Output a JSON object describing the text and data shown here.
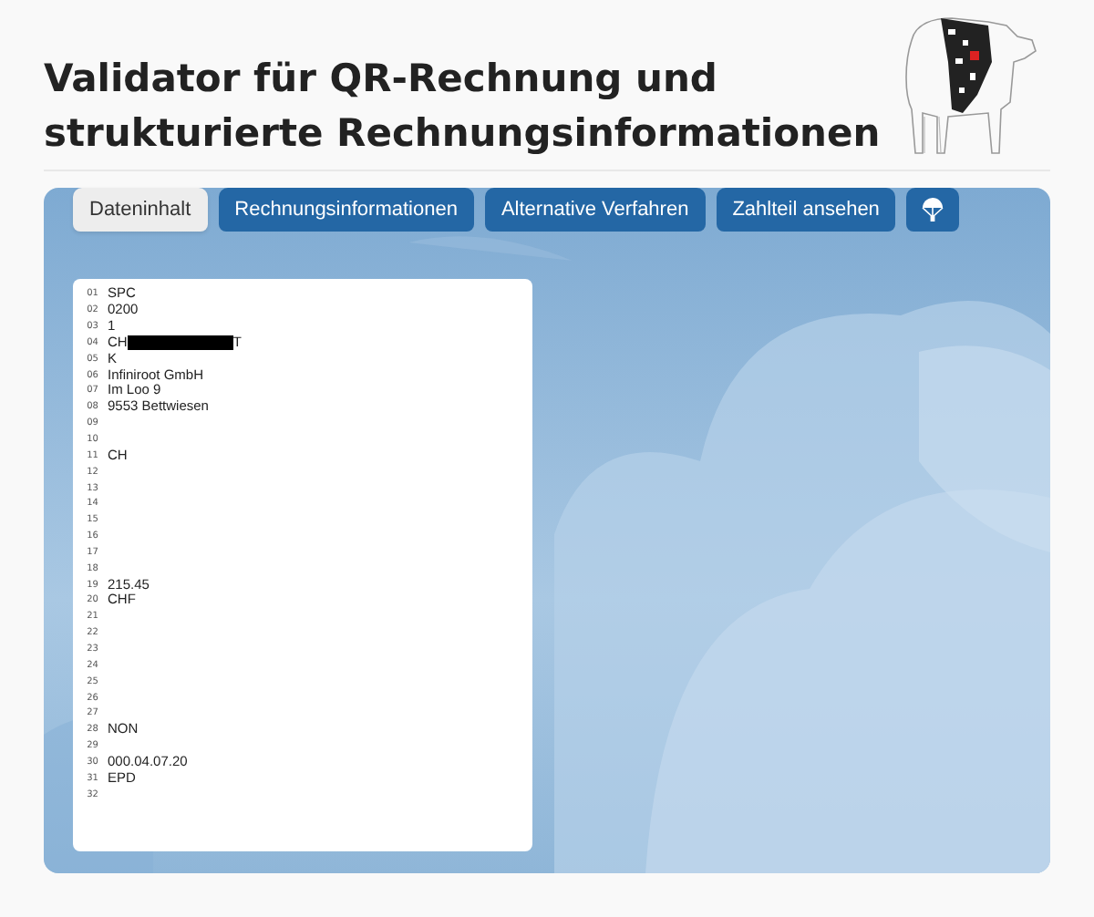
{
  "title_lines": [
    "Validator für QR-Rechnung und",
    "strukturierte Rechnungsinformationen"
  ],
  "tabs": [
    {
      "kind": "text",
      "label": "Dateninhalt",
      "selected": true
    },
    {
      "kind": "text",
      "label": "Rechnungsinformationen",
      "selected": false
    },
    {
      "kind": "text",
      "label": "Alternative Verfahren",
      "selected": false
    },
    {
      "kind": "text",
      "label": "Zahlteil ansehen",
      "selected": false
    },
    {
      "kind": "icon",
      "selected": false
    }
  ],
  "lines": [
    {
      "number": "01",
      "kind": "text",
      "value": "SPC"
    },
    {
      "number": "02",
      "kind": "text",
      "value": "0200"
    },
    {
      "number": "03",
      "kind": "text",
      "value": "1"
    },
    {
      "number": "04",
      "kind": "redacted",
      "value": "CH",
      "suffix": "T"
    },
    {
      "number": "05",
      "kind": "text",
      "value": "K"
    },
    {
      "number": "06",
      "kind": "text",
      "value": "Infiniroot GmbH"
    },
    {
      "number": "07",
      "kind": "text",
      "value": "Im Loo 9"
    },
    {
      "number": "08",
      "kind": "text",
      "value": "9553 Bettwiesen"
    },
    {
      "number": "09",
      "kind": "empty"
    },
    {
      "number": "10",
      "kind": "empty"
    },
    {
      "number": "11",
      "kind": "text",
      "value": "CH"
    },
    {
      "number": "12",
      "kind": "empty"
    },
    {
      "number": "13",
      "kind": "empty"
    },
    {
      "number": "14",
      "kind": "empty"
    },
    {
      "number": "15",
      "kind": "empty"
    },
    {
      "number": "16",
      "kind": "empty"
    },
    {
      "number": "17",
      "kind": "empty"
    },
    {
      "number": "18",
      "kind": "empty"
    },
    {
      "number": "19",
      "kind": "text",
      "value": "215.45"
    },
    {
      "number": "20",
      "kind": "text",
      "value": "CHF"
    },
    {
      "number": "21",
      "kind": "empty"
    },
    {
      "number": "22",
      "kind": "empty"
    },
    {
      "number": "23",
      "kind": "empty"
    },
    {
      "number": "24",
      "kind": "empty"
    },
    {
      "number": "25",
      "kind": "empty"
    },
    {
      "number": "26",
      "kind": "empty"
    },
    {
      "number": "27",
      "kind": "empty"
    },
    {
      "number": "28",
      "kind": "text",
      "value": "NON"
    },
    {
      "number": "29",
      "kind": "empty"
    },
    {
      "number": "30",
      "kind": "text",
      "value": "000.04.07.20"
    },
    {
      "number": "31",
      "kind": "text",
      "value": "EPD"
    },
    {
      "number": "32",
      "kind": "empty"
    }
  ]
}
